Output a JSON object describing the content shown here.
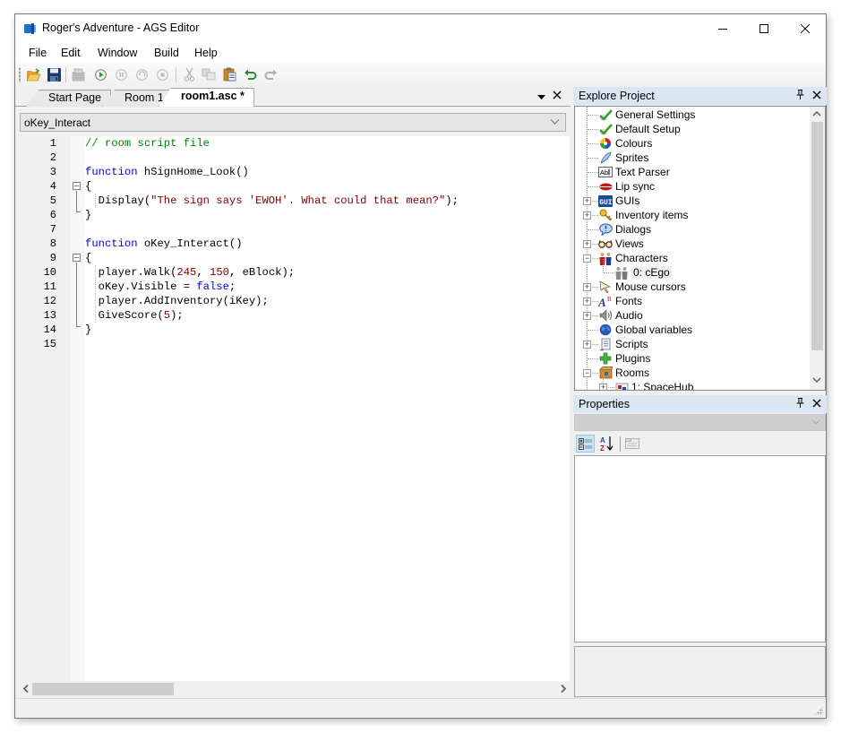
{
  "window": {
    "title": "Roger's Adventure - AGS Editor",
    "controls": {
      "minimize": "minimize",
      "maximize": "maximize",
      "close": "close"
    }
  },
  "menu": [
    "File",
    "Edit",
    "Window",
    "Build",
    "Help"
  ],
  "toolbar": {
    "buttons": [
      {
        "name": "open-project",
        "icon": "folder-open-icon",
        "enabled": true
      },
      {
        "name": "save",
        "icon": "floppy-disk-icon",
        "enabled": true
      },
      {
        "name": "build-exe",
        "icon": "build-icon",
        "enabled": false
      },
      {
        "name": "run",
        "icon": "play-icon",
        "enabled": true
      },
      {
        "name": "pause",
        "icon": "pause-icon",
        "enabled": false
      },
      {
        "name": "step",
        "icon": "step-icon",
        "enabled": false
      },
      {
        "name": "stop",
        "icon": "stop-icon",
        "enabled": false
      },
      {
        "name": "cut",
        "icon": "scissors-icon",
        "enabled": false
      },
      {
        "name": "copy",
        "icon": "copy-icon",
        "enabled": false
      },
      {
        "name": "paste",
        "icon": "paste-icon",
        "enabled": true
      },
      {
        "name": "undo",
        "icon": "undo-icon",
        "enabled": true
      },
      {
        "name": "redo",
        "icon": "redo-icon",
        "enabled": false
      }
    ]
  },
  "tabs": [
    {
      "label": "Start Page",
      "active": false
    },
    {
      "label": "Room 1",
      "active": false
    },
    {
      "label": "room1.asc *",
      "active": true
    }
  ],
  "function_dropdown": {
    "value": "oKey_Interact"
  },
  "code": {
    "lines": [
      {
        "n": "1",
        "tokens": [
          [
            "comment",
            "// room script file"
          ]
        ]
      },
      {
        "n": "2",
        "tokens": []
      },
      {
        "n": "3",
        "tokens": [
          [
            "kw",
            "function"
          ],
          [
            "plain",
            " hSignHome_Look()"
          ]
        ]
      },
      {
        "n": "4",
        "tokens": [
          [
            "plain",
            "{"
          ]
        ]
      },
      {
        "n": "5",
        "tokens": [
          [
            "plain",
            "  Display("
          ],
          [
            "str",
            "\"The sign says 'EWOH'. What could that mean?\""
          ],
          [
            "plain",
            ");"
          ]
        ]
      },
      {
        "n": "6",
        "tokens": [
          [
            "plain",
            "}"
          ]
        ]
      },
      {
        "n": "7",
        "tokens": []
      },
      {
        "n": "8",
        "tokens": [
          [
            "kw",
            "function"
          ],
          [
            "plain",
            " oKey_Interact()"
          ]
        ]
      },
      {
        "n": "9",
        "tokens": [
          [
            "plain",
            "{"
          ]
        ]
      },
      {
        "n": "10",
        "tokens": [
          [
            "plain",
            "  player.Walk("
          ],
          [
            "num",
            "245"
          ],
          [
            "plain",
            ", "
          ],
          [
            "num",
            "150"
          ],
          [
            "plain",
            ", eBlock);"
          ]
        ]
      },
      {
        "n": "11",
        "tokens": [
          [
            "plain",
            "  oKey.Visible = "
          ],
          [
            "kw",
            "false"
          ],
          [
            "plain",
            ";"
          ]
        ]
      },
      {
        "n": "12",
        "tokens": [
          [
            "plain",
            "  player.AddInventory(iKey);"
          ]
        ]
      },
      {
        "n": "13",
        "tokens": [
          [
            "plain",
            "  GiveScore("
          ],
          [
            "num",
            "5"
          ],
          [
            "plain",
            ");"
          ]
        ]
      },
      {
        "n": "14",
        "tokens": [
          [
            "plain",
            "}"
          ]
        ]
      },
      {
        "n": "15",
        "tokens": []
      }
    ]
  },
  "explore_project": {
    "title": "Explore Project",
    "items": [
      {
        "label": "General Settings",
        "icon": "checkmark-icon",
        "level": 0,
        "expander": null
      },
      {
        "label": "Default Setup",
        "icon": "checkmark-icon",
        "level": 0,
        "expander": null
      },
      {
        "label": "Colours",
        "icon": "palette-icon",
        "level": 0,
        "expander": null
      },
      {
        "label": "Sprites",
        "icon": "feather-icon",
        "level": 0,
        "expander": null
      },
      {
        "label": "Text Parser",
        "icon": "text-parser-icon",
        "level": 0,
        "expander": null
      },
      {
        "label": "Lip sync",
        "icon": "lips-icon",
        "level": 0,
        "expander": null
      },
      {
        "label": "GUIs",
        "icon": "gui-icon",
        "level": 0,
        "expander": "+"
      },
      {
        "label": "Inventory items",
        "icon": "key-icon",
        "level": 0,
        "expander": "+"
      },
      {
        "label": "Dialogs",
        "icon": "speech-bubble-icon",
        "level": 0,
        "expander": null
      },
      {
        "label": "Views",
        "icon": "glasses-icon",
        "level": 0,
        "expander": "+"
      },
      {
        "label": "Characters",
        "icon": "characters-icon",
        "level": 0,
        "expander": "-"
      },
      {
        "label": "0: cEgo",
        "icon": "character-icon",
        "level": 1,
        "expander": null
      },
      {
        "label": "Mouse cursors",
        "icon": "cursor-icon",
        "level": 0,
        "expander": "+"
      },
      {
        "label": "Fonts",
        "icon": "font-icon",
        "level": 0,
        "expander": "+"
      },
      {
        "label": "Audio",
        "icon": "speaker-icon",
        "level": 0,
        "expander": "+"
      },
      {
        "label": "Global variables",
        "icon": "globe-icon",
        "level": 0,
        "expander": null
      },
      {
        "label": "Scripts",
        "icon": "scroll-icon",
        "level": 0,
        "expander": "+"
      },
      {
        "label": "Plugins",
        "icon": "puzzle-icon",
        "level": 0,
        "expander": null
      },
      {
        "label": "Rooms",
        "icon": "rooms-icon",
        "level": 0,
        "expander": "-"
      },
      {
        "label": "1: SpaceHub",
        "icon": "room-icon",
        "level": 1,
        "expander": "+"
      }
    ]
  },
  "properties": {
    "title": "Properties",
    "combo_value": "",
    "toolbar": [
      "categorized",
      "alphabetical",
      "property-pages"
    ]
  },
  "colors": {
    "accent_panel_header": "#dbe6f3",
    "code_keyword": "#0000ff",
    "code_comment": "#008000",
    "code_string": "#800000"
  }
}
